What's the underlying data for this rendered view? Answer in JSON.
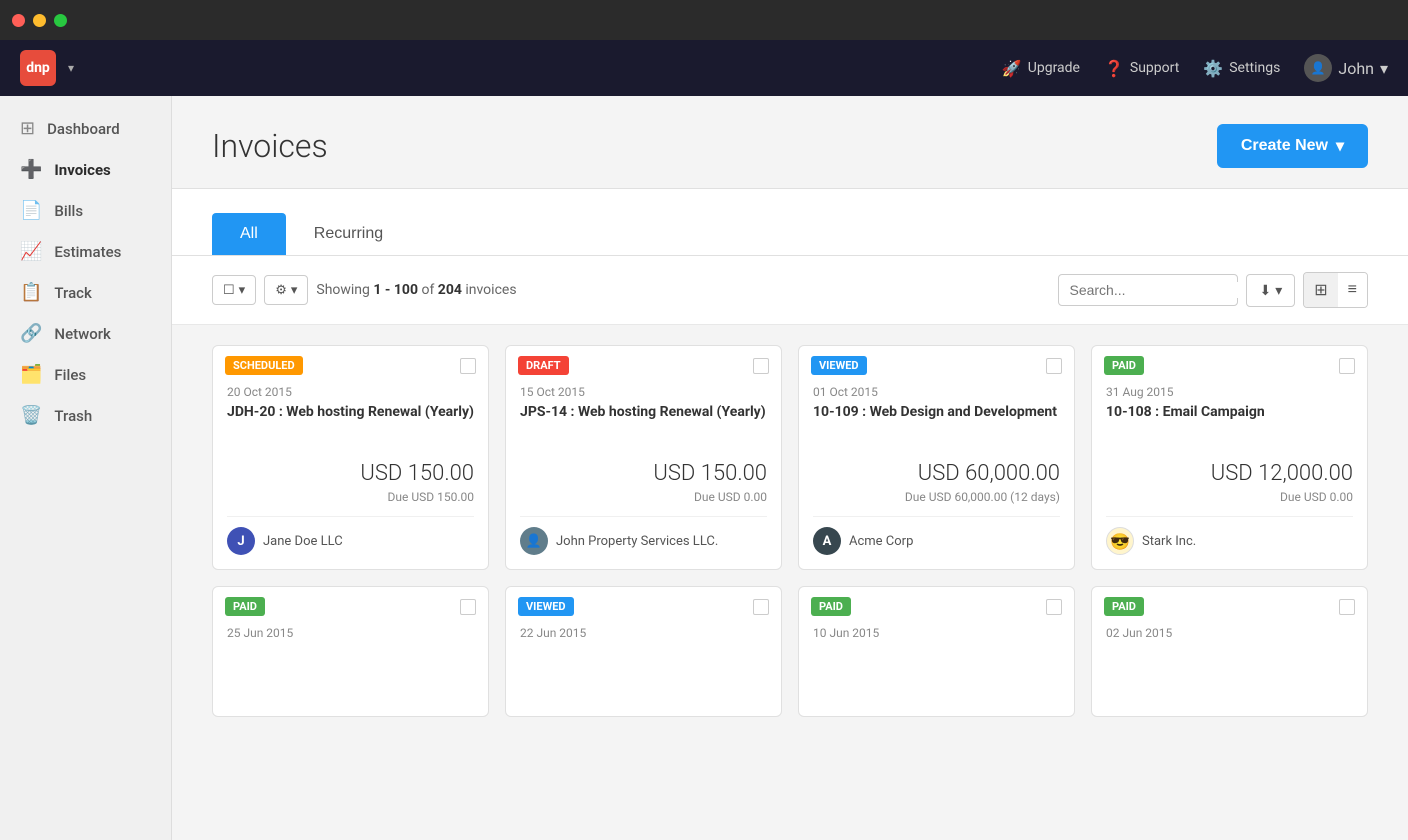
{
  "window": {
    "dots": [
      "red",
      "yellow",
      "green"
    ]
  },
  "topnav": {
    "logo_text": "dnp",
    "actions": [
      {
        "id": "upgrade",
        "icon": "🚀",
        "label": "Upgrade"
      },
      {
        "id": "support",
        "icon": "❓",
        "label": "Support"
      },
      {
        "id": "settings",
        "icon": "⚙️",
        "label": "Settings"
      }
    ],
    "user": {
      "name": "John",
      "chevron": "▾"
    }
  },
  "sidebar": {
    "items": [
      {
        "id": "dashboard",
        "icon": "📊",
        "label": "Dashboard",
        "active": false
      },
      {
        "id": "invoices",
        "icon": "➕",
        "label": "Invoices",
        "active": true
      },
      {
        "id": "bills",
        "icon": "📄",
        "label": "Bills",
        "active": false
      },
      {
        "id": "estimates",
        "icon": "📈",
        "label": "Estimates",
        "active": false
      },
      {
        "id": "track",
        "icon": "📋",
        "label": "Track",
        "active": false
      },
      {
        "id": "network",
        "icon": "🔗",
        "label": "Network",
        "active": false
      },
      {
        "id": "files",
        "icon": "🗂️",
        "label": "Files",
        "active": false
      },
      {
        "id": "trash",
        "icon": "🗑️",
        "label": "Trash",
        "active": false
      }
    ]
  },
  "page": {
    "title": "Invoices",
    "create_new_label": "Create New",
    "create_chevron": "▾"
  },
  "tabs": [
    {
      "id": "all",
      "label": "All",
      "active": true
    },
    {
      "id": "recurring",
      "label": "Recurring",
      "active": false
    }
  ],
  "toolbar": {
    "showing_prefix": "Showing ",
    "showing_range": "1 - 100",
    "showing_of": " of ",
    "showing_total": "204",
    "showing_suffix": " invoices",
    "search_placeholder": "Search..."
  },
  "cards": [
    {
      "status": "SCHEDULED",
      "status_class": "status-scheduled",
      "date": "20 Oct 2015",
      "title": "JDH-20 : Web hosting Renewal (Yearly)",
      "amount": "USD 150.00",
      "due": "Due USD 150.00",
      "client_name": "Jane Doe LLC",
      "client_initial": "J",
      "avatar_class": "avatar-blue"
    },
    {
      "status": "DRAFT",
      "status_class": "status-draft",
      "date": "15 Oct 2015",
      "title": "JPS-14 : Web hosting Renewal (Yearly)",
      "amount": "USD 150.00",
      "due": "Due USD 0.00",
      "client_name": "John Property Services LLC.",
      "client_initial": "👤",
      "avatar_class": "avatar-gray"
    },
    {
      "status": "VIEWED",
      "status_class": "status-viewed",
      "date": "01 Oct 2015",
      "title": "10-109 : Web Design and Development",
      "amount": "USD 60,000.00",
      "due": "Due USD 60,000.00 (12 days)",
      "client_name": "Acme Corp",
      "client_initial": "A",
      "avatar_class": "avatar-dark"
    },
    {
      "status": "PAID",
      "status_class": "status-paid",
      "date": "31 Aug 2015",
      "title": "10-108 : Email Campaign",
      "amount": "USD 12,000.00",
      "due": "Due USD 0.00",
      "client_name": "Stark Inc.",
      "client_initial": "😎",
      "avatar_class": "avatar-emoji"
    },
    {
      "status": "PAID",
      "status_class": "status-paid",
      "date": "25 Jun 2015",
      "title": "",
      "amount": "",
      "due": "",
      "client_name": "",
      "client_initial": "",
      "avatar_class": "avatar-blue"
    },
    {
      "status": "VIEWED",
      "status_class": "status-viewed",
      "date": "22 Jun 2015",
      "title": "",
      "amount": "",
      "due": "",
      "client_name": "",
      "client_initial": "",
      "avatar_class": "avatar-gray"
    },
    {
      "status": "PAID",
      "status_class": "status-paid",
      "date": "10 Jun 2015",
      "title": "",
      "amount": "",
      "due": "",
      "client_name": "",
      "client_initial": "",
      "avatar_class": "avatar-dark"
    },
    {
      "status": "PAID",
      "status_class": "status-paid",
      "date": "02 Jun 2015",
      "title": "",
      "amount": "",
      "due": "",
      "client_name": "",
      "client_initial": "",
      "avatar_class": "avatar-blue"
    }
  ]
}
